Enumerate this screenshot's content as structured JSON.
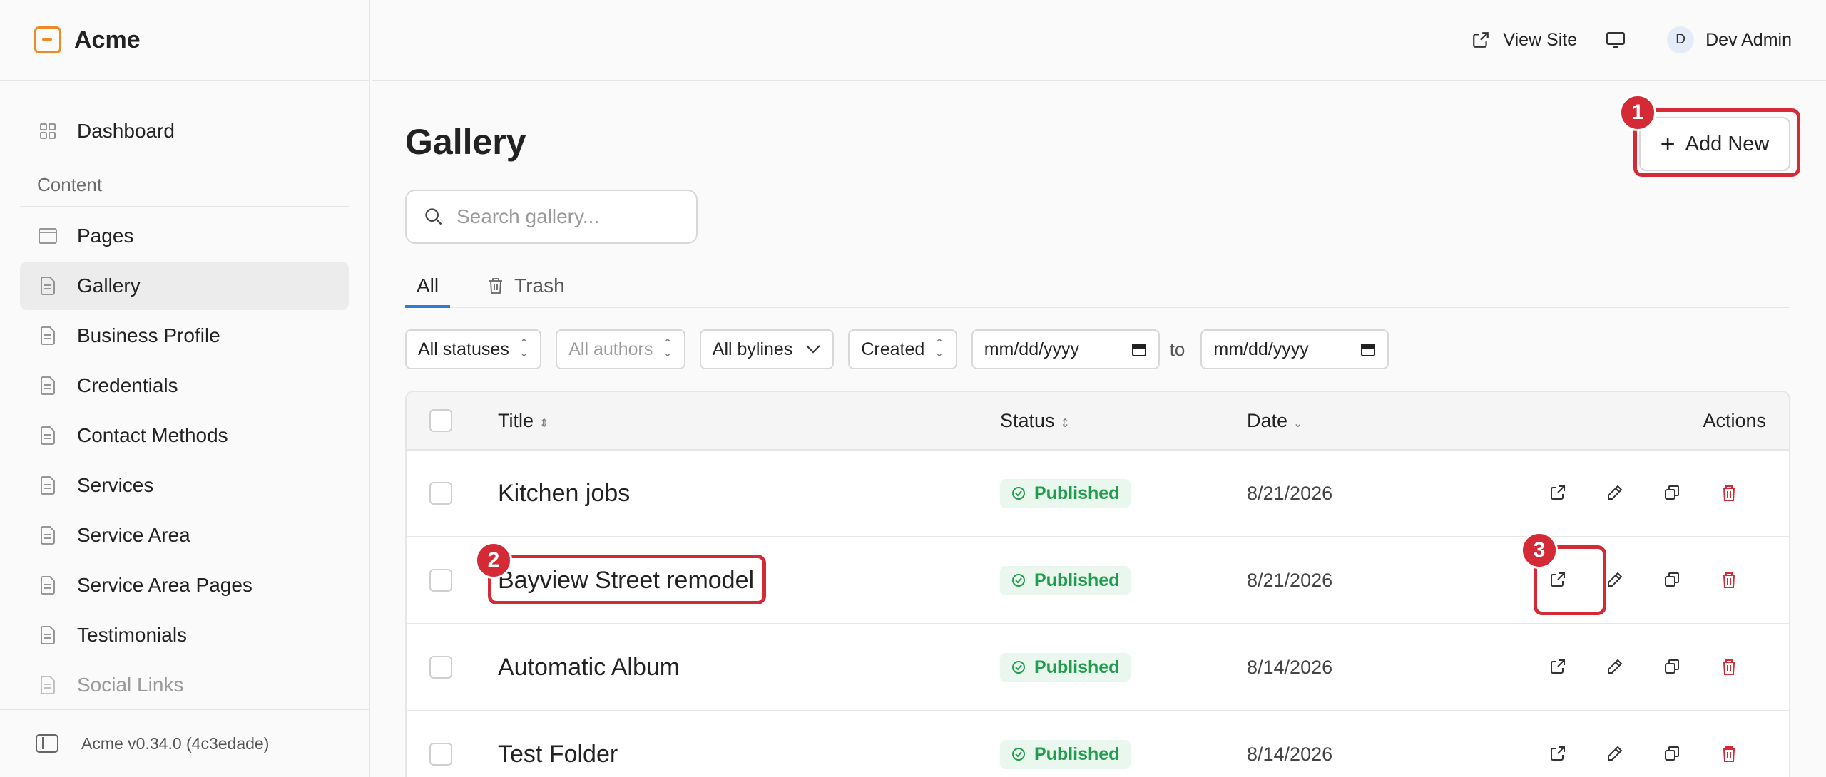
{
  "brand": {
    "name": "Acme"
  },
  "sidebar": {
    "dashboard": "Dashboard",
    "section_label": "Content",
    "items": [
      {
        "label": "Pages",
        "icon": "page-icon"
      },
      {
        "label": "Gallery",
        "icon": "document-icon",
        "active": true
      },
      {
        "label": "Business Profile",
        "icon": "document-icon"
      },
      {
        "label": "Credentials",
        "icon": "document-icon"
      },
      {
        "label": "Contact Methods",
        "icon": "document-icon"
      },
      {
        "label": "Services",
        "icon": "document-icon"
      },
      {
        "label": "Service Area",
        "icon": "document-icon"
      },
      {
        "label": "Service Area Pages",
        "icon": "document-icon"
      },
      {
        "label": "Testimonials",
        "icon": "document-icon"
      },
      {
        "label": "Social Links",
        "icon": "document-icon"
      }
    ],
    "footer_version": "Acme v0.34.0 (4c3edade)"
  },
  "topbar": {
    "view_site": "View Site",
    "avatar_initial": "D",
    "user_name": "Dev Admin"
  },
  "main": {
    "title": "Gallery",
    "add_new": "Add New",
    "search_placeholder": "Search gallery...",
    "tabs": [
      "All",
      "Trash"
    ],
    "filters": {
      "statuses": "All statuses",
      "authors": "All authors",
      "bylines": "All bylines",
      "sort": "Created",
      "date_from": "mm/dd/yyyy",
      "to": "to",
      "date_to": "mm/dd/yyyy"
    },
    "table": {
      "headers": {
        "title": "Title",
        "status": "Status",
        "date": "Date",
        "actions": "Actions"
      },
      "rows": [
        {
          "title": "Kitchen jobs",
          "status": "Published",
          "date": "8/21/2026"
        },
        {
          "title": "Bayview Street remodel",
          "status": "Published",
          "date": "8/21/2026"
        },
        {
          "title": "Automatic Album",
          "status": "Published",
          "date": "8/14/2026"
        },
        {
          "title": "Test Folder",
          "status": "Published",
          "date": "8/14/2026"
        }
      ]
    }
  },
  "annotations": [
    "1",
    "2",
    "3"
  ],
  "colors": {
    "accent": "#2f7bd6",
    "brand": "#f08a24",
    "published": "#1f9d4c",
    "danger": "#d42a35"
  }
}
